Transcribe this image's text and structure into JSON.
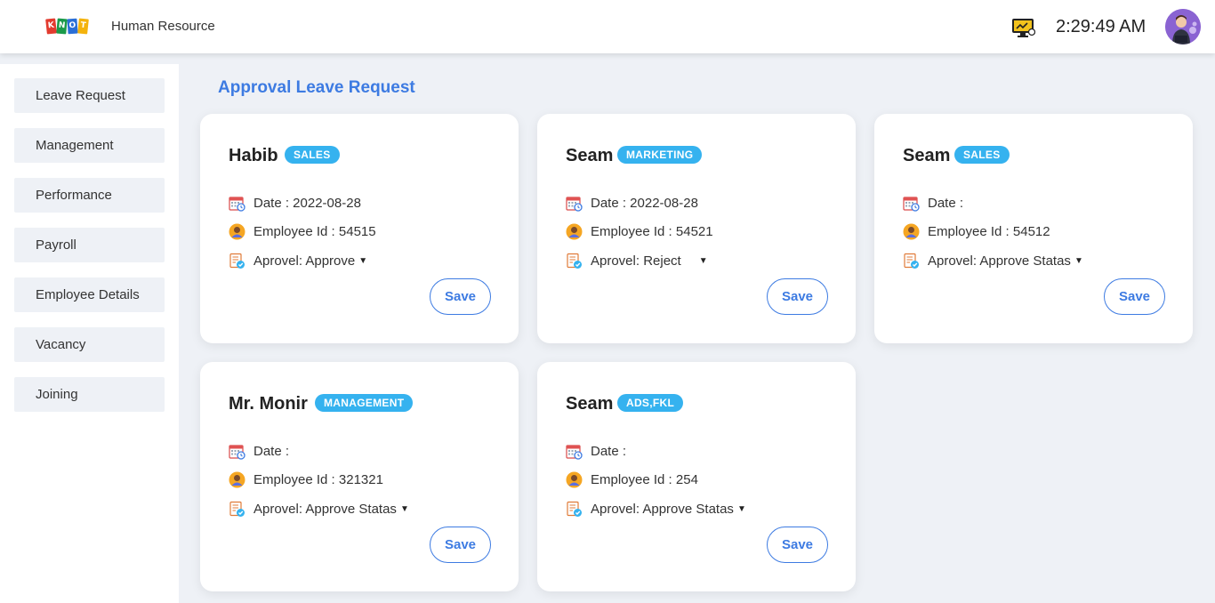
{
  "header": {
    "logo_letters": [
      "K",
      "N",
      "O",
      "T"
    ],
    "app_title": "Human Resource",
    "clock": "2:29:49 AM",
    "icons": [
      "monitor-icon",
      "avatar"
    ]
  },
  "sidebar": {
    "items": [
      {
        "label": "Leave Request"
      },
      {
        "label": "Management"
      },
      {
        "label": "Performance"
      },
      {
        "label": "Payroll"
      },
      {
        "label": "Employee Details"
      },
      {
        "label": "Vacancy"
      },
      {
        "label": "Joining"
      }
    ]
  },
  "main": {
    "title": "Approval Leave Request",
    "cards": [
      {
        "name": "Habib",
        "department": "SALES",
        "date_label": "Date : 2022-08-28",
        "employee_label": "Employee Id : 54515",
        "approval_label": "Aprovel: Approve",
        "save_label": "Save"
      },
      {
        "name": "Seam",
        "department": "MARKETING",
        "date_label": "Date : 2022-08-28",
        "employee_label": "Employee Id : 54521",
        "approval_label": "Aprovel: Reject",
        "save_label": "Save"
      },
      {
        "name": "Seam",
        "department": "SALES",
        "date_label": "Date :",
        "employee_label": "Employee Id : 54512",
        "approval_label": "Aprovel: Approve Statas",
        "save_label": "Save"
      },
      {
        "name": "Mr. Monir",
        "department": "MANAGEMENT",
        "date_label": "Date :",
        "employee_label": "Employee Id : 321321",
        "approval_label": "Aprovel: Approve Statas",
        "save_label": "Save"
      },
      {
        "name": "Seam",
        "department": "ADS,FKL",
        "date_label": "Date :",
        "employee_label": "Employee Id : 254",
        "approval_label": "Aprovel: Approve Statas",
        "save_label": "Save"
      }
    ]
  },
  "colors": {
    "accent": "#3d7be2",
    "badge": "#35b2ef",
    "background": "#eef1f6"
  }
}
